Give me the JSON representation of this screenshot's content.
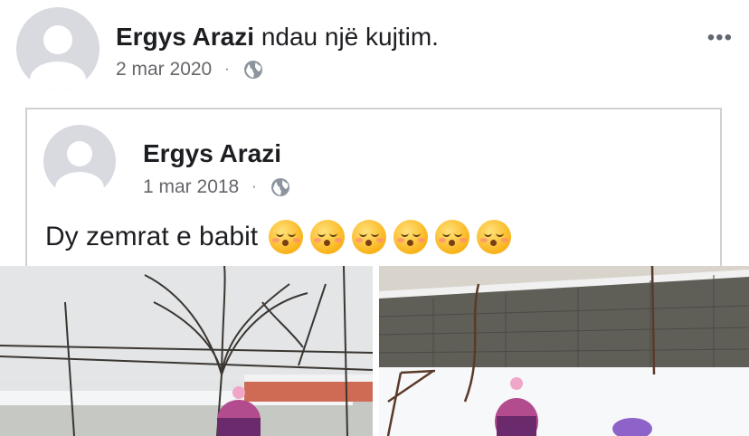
{
  "post": {
    "author": "Ergys Arazi",
    "action": "ndau një kujtim.",
    "date": "2 mar 2020",
    "separator": "·",
    "privacy_icon": "globe-icon",
    "more_label": "•••"
  },
  "shared": {
    "author": "Ergys Arazi",
    "date": "1 mar 2018",
    "separator": "·",
    "privacy_icon": "globe-icon",
    "text": "Dy zemrat e babit",
    "emoji_icon": "kissing-face-smiling-eyes-emoji",
    "emoji_count": 6
  },
  "photos": [
    {
      "icon": "photo-snow-garden-left"
    },
    {
      "icon": "photo-snow-garden-right"
    }
  ]
}
